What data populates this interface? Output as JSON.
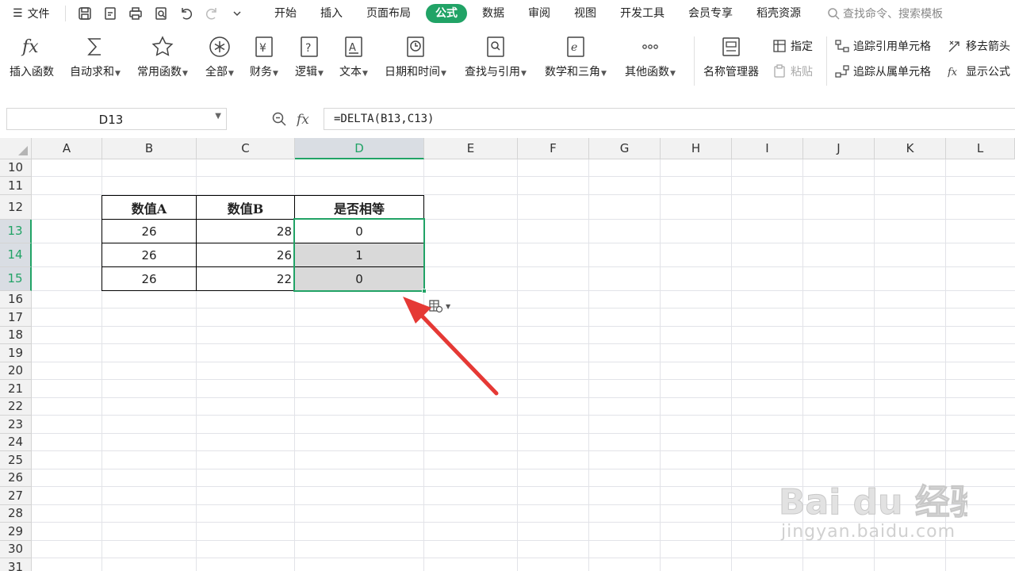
{
  "menubar": {
    "file_label": "文件",
    "tabs": [
      {
        "label": "开始",
        "active": false
      },
      {
        "label": "插入",
        "active": false
      },
      {
        "label": "页面布局",
        "active": false
      },
      {
        "label": "公式",
        "active": true
      },
      {
        "label": "数据",
        "active": false
      },
      {
        "label": "审阅",
        "active": false
      },
      {
        "label": "视图",
        "active": false
      },
      {
        "label": "开发工具",
        "active": false
      },
      {
        "label": "会员专享",
        "active": false
      },
      {
        "label": "稻壳资源",
        "active": false
      }
    ],
    "search_placeholder": "查找命令、搜索模板"
  },
  "ribbon": {
    "insert_function": "插入函数",
    "autosum": "自动求和",
    "common_functions": "常用函数",
    "all": "全部",
    "finance": "财务",
    "logical": "逻辑",
    "text": "文本",
    "datetime": "日期和时间",
    "lookup": "查找与引用",
    "math": "数学和三角",
    "other": "其他函数",
    "name_manager": "名称管理器",
    "define": "指定",
    "paste": "粘贴",
    "trace_precedents": "追踪引用单元格",
    "trace_dependents": "追踪从属单元格",
    "remove_arrows": "移去箭头",
    "show_formulas": "显示公式"
  },
  "formula_bar": {
    "name_box": "D13",
    "formula": "=DELTA(B13,C13)"
  },
  "columns": [
    "A",
    "B",
    "C",
    "D",
    "E",
    "F",
    "G",
    "H",
    "I",
    "J",
    "K",
    "L"
  ],
  "selected_column": "D",
  "rows": [
    "10",
    "11",
    "12",
    "13",
    "14",
    "15",
    "16",
    "17",
    "18",
    "19",
    "20",
    "21",
    "22",
    "23",
    "24",
    "25",
    "26",
    "27",
    "28",
    "29",
    "30",
    "31"
  ],
  "selected_rows": [
    "13",
    "14",
    "15"
  ],
  "table": {
    "headers": [
      "数值A",
      "数值B",
      "是否相等"
    ],
    "rows": [
      {
        "a": "26",
        "b": "28",
        "d": "0"
      },
      {
        "a": "26",
        "b": "26",
        "d": "1"
      },
      {
        "a": "26",
        "b": "22",
        "d": "0"
      }
    ]
  },
  "watermark": {
    "brand": "Bai du 经验",
    "url": "jingyan.baidu.com"
  },
  "colors": {
    "accent": "#21a366",
    "annotation_arrow": "#e53935"
  }
}
